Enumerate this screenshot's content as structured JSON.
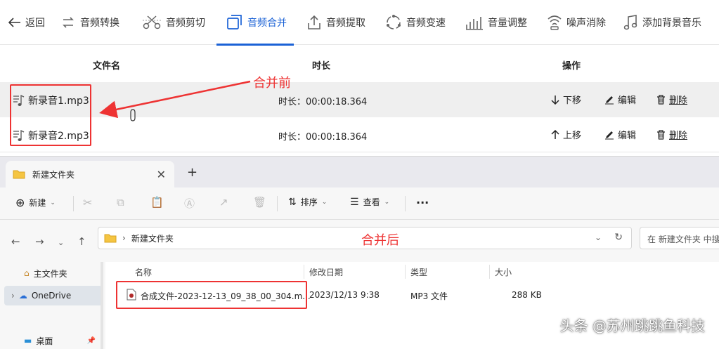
{
  "toolbar": {
    "back": "返回",
    "items": [
      "音频转换",
      "音频剪切",
      "音频合并",
      "音频提取",
      "音频变速",
      "音量调整",
      "噪声消除",
      "添加背景音乐"
    ],
    "active_index": 2
  },
  "table": {
    "headers": {
      "filename": "文件名",
      "duration": "时长",
      "actions": "操作"
    },
    "rows": [
      {
        "filename": "新录音1.mp3",
        "duration": "时长：00:00:18.364",
        "move": "下移",
        "edit": "编辑",
        "delete": "删除"
      },
      {
        "filename": "新录音2.mp3",
        "duration": "时长：00:00:18.364",
        "move": "上移",
        "edit": "编辑",
        "delete": "删除"
      }
    ]
  },
  "annotations": {
    "before": "合并前",
    "after": "合并后"
  },
  "explorer": {
    "tab_title": "新建文件夹",
    "new_tab": "+",
    "commands": {
      "new": "新建",
      "sort": "排序",
      "view": "查看",
      "more": "···"
    },
    "address": {
      "path": "新建文件夹"
    },
    "search_placeholder": "在 新建文件夹 中搜",
    "sidebar": [
      {
        "label": "主文件夹"
      },
      {
        "label": "OneDrive"
      },
      {
        "label": "桌面"
      }
    ],
    "columns": {
      "name": "名称",
      "modified": "修改日期",
      "type": "类型",
      "size": "大小"
    },
    "files": [
      {
        "name": "合成文件-2023-12-13_09_38_00_304.m...",
        "modified": "2023/12/13 9:38",
        "type": "MP3 文件",
        "size": "288 KB"
      }
    ]
  },
  "watermark": "头条 @苏州跳跳鱼科技",
  "colors": {
    "accent": "#1b62d6",
    "annotation": "#e33333"
  }
}
